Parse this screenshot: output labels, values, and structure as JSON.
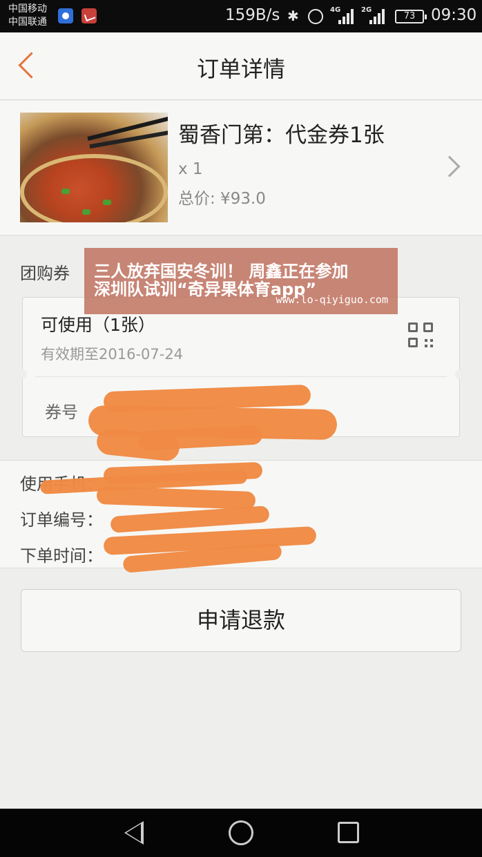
{
  "status_bar": {
    "carrier_1": "中国移动",
    "carrier_2": "中国联通",
    "network_speed": "159B/s",
    "sig1_type": "4G",
    "sig2_type": "2G",
    "battery": "73",
    "time": "09:30"
  },
  "header": {
    "title": "订单详情"
  },
  "product": {
    "name": "蜀香门第：代金券1张",
    "quantity": "x 1",
    "total": "总价: ¥93.0"
  },
  "coupon": {
    "section_label": "团购券",
    "status": "可使用（1张）",
    "valid_until": "有效期至2016-07-24",
    "number_label": "券号"
  },
  "order_info": {
    "phone_label": "使用手机：",
    "order_no_label": "订单编号：",
    "order_time_label": "下单时间："
  },
  "refund_button": "申请退款",
  "watermark": {
    "line1": "三人放弃国安冬训！ 周鑫正在参加",
    "line2": "深圳队试训“奇异果体育app”",
    "url": "www.lo-qiyiguo.com"
  },
  "colors": {
    "accent": "#e4743d",
    "scribble": "#ef8a44"
  }
}
